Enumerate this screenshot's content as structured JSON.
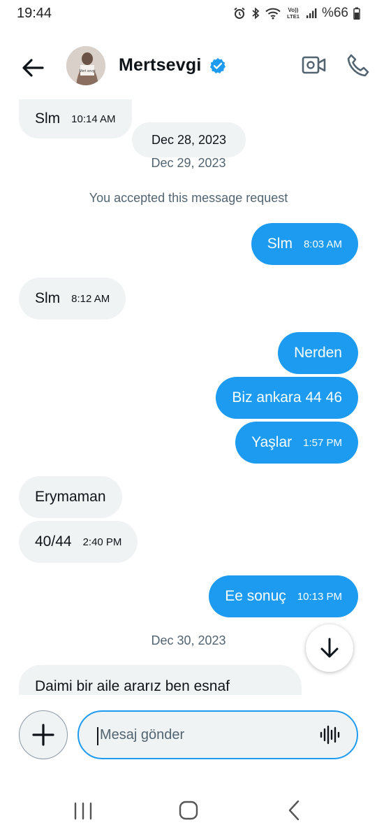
{
  "status_bar": {
    "time": "19:44",
    "battery": "%66",
    "icons": [
      "alarm-icon",
      "bluetooth-icon",
      "wifi-icon",
      "volte-icon",
      "signal-icon",
      "battery-icon"
    ],
    "volte_label": "Vo)) LTE1"
  },
  "header": {
    "contact_name": "Mertsevgi",
    "verified": true,
    "avatar_caption": "Mert sevgi"
  },
  "conversation": {
    "items": [
      {
        "type": "message",
        "direction": "incoming",
        "text": "Slm",
        "time": "10:14 AM"
      },
      {
        "type": "date",
        "text": "Dec 28, 2023"
      },
      {
        "type": "date",
        "text": "Dec 29, 2023"
      },
      {
        "type": "system",
        "text": "You accepted this message request"
      },
      {
        "type": "message",
        "direction": "outgoing",
        "text": "Slm",
        "time": "8:03 AM"
      },
      {
        "type": "message",
        "direction": "incoming",
        "text": "Slm",
        "time": "8:12 AM"
      },
      {
        "type": "message",
        "direction": "outgoing",
        "text": "Nerden",
        "time": ""
      },
      {
        "type": "message",
        "direction": "outgoing",
        "text": "Biz ankara 44 46",
        "time": ""
      },
      {
        "type": "message",
        "direction": "outgoing",
        "text": "Yaşlar",
        "time": "1:57 PM"
      },
      {
        "type": "message",
        "direction": "incoming",
        "text": "Erymaman",
        "time": ""
      },
      {
        "type": "message",
        "direction": "incoming",
        "text": "40/44",
        "time": "2:40 PM"
      },
      {
        "type": "message",
        "direction": "outgoing",
        "text": "Ee sonuç",
        "time": "10:13 PM"
      },
      {
        "type": "date",
        "text": "Dec 30, 2023"
      },
      {
        "type": "message",
        "direction": "incoming",
        "text": "Daimi bir aile ararız ben esnaf",
        "time": ""
      }
    ]
  },
  "composer": {
    "placeholder": "Mesaj gönder"
  },
  "colors": {
    "accent": "#1d9bf0",
    "incoming_bubble": "#eff3f4",
    "secondary_text": "#536471"
  }
}
